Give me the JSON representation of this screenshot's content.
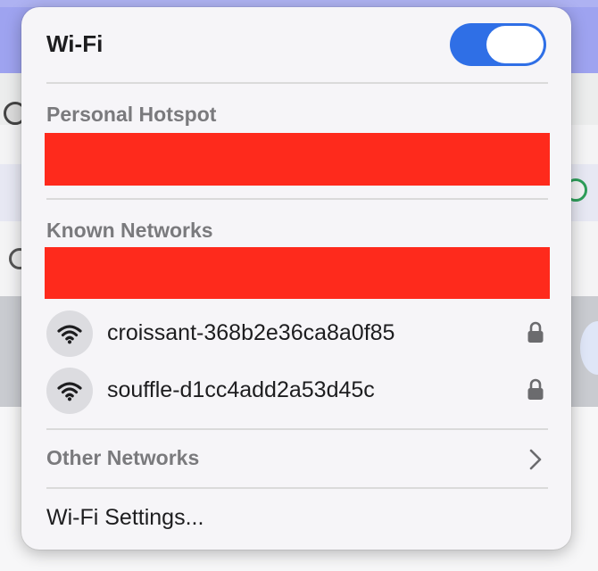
{
  "menu": {
    "title": "Wi-Fi",
    "toggle_on": true,
    "personal_hotspot_label": "Personal Hotspot",
    "known_networks_label": "Known Networks",
    "networks": [
      {
        "name": "croissant-368b2e36ca8a0f85",
        "icon": "wifi-icon",
        "secured": true
      },
      {
        "name": "souffle-d1cc4add2a53d45c",
        "icon": "wifi-icon",
        "secured": true
      }
    ],
    "other_networks_label": "Other Networks",
    "settings_label": "Wi-Fi Settings..."
  },
  "colors": {
    "toggle_on": "#2f6fe6",
    "redaction": "#fe2a1c",
    "label_gray": "#7a7a7d"
  }
}
